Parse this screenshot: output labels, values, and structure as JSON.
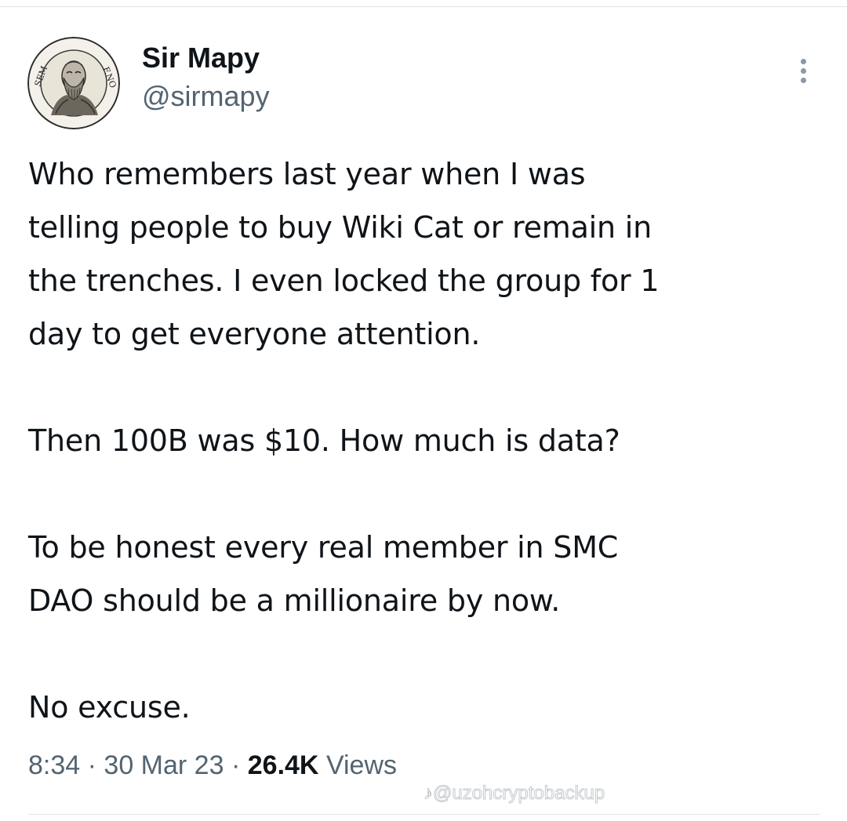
{
  "user": {
    "display_name": "Sir Mapy",
    "handle": "@sirmapy",
    "avatar_icon": "engraved-portrait-medallion",
    "avatar_text_left": "SEM",
    "avatar_text_right": "F.NO"
  },
  "tweet": {
    "paragraphs": [
      "Who remembers last year when I was\ntelling people to buy Wiki Cat or remain in\nthe trenches. I even locked the group for 1\nday to get everyone attention.",
      "Then 100B was $10. How much is data?",
      "To be honest every real member in SMC\nDAO should be a millionaire by now.",
      "No excuse."
    ],
    "time": "8:34",
    "date": "30 Mar 23",
    "separator": "·",
    "views_count": "26.4K",
    "views_label": "Views"
  },
  "watermark": "♪@uzohcryptobackup",
  "colors": {
    "text": "#0f1419",
    "secondary": "#536471",
    "divider": "#e1e4e6"
  }
}
